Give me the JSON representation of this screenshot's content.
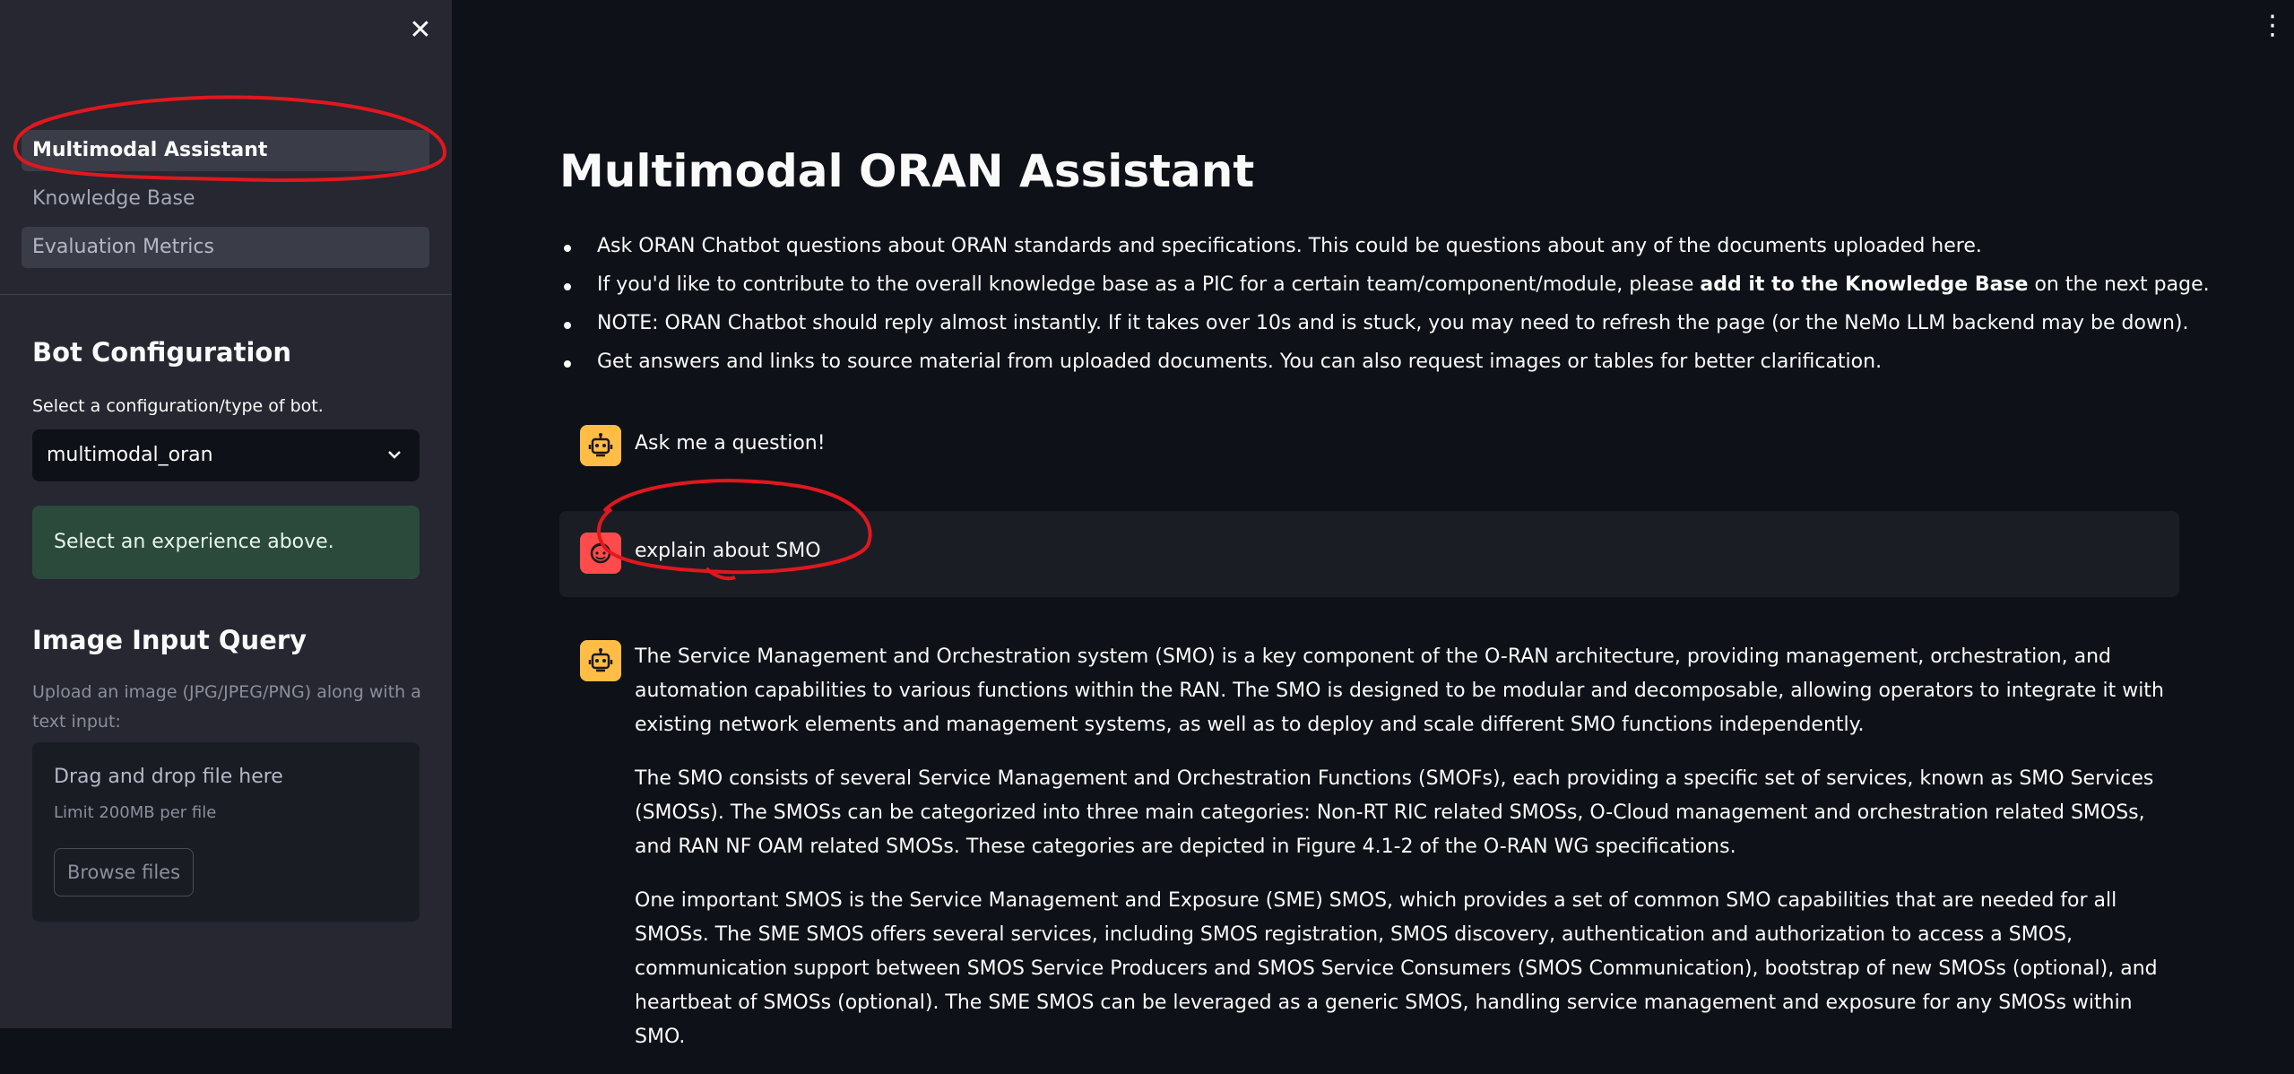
{
  "sidebar": {
    "nav": [
      "Multimodal Assistant",
      "Knowledge Base",
      "Evaluation Metrics"
    ],
    "bot_config": {
      "heading": "Bot Configuration",
      "label": "Select a configuration/type of bot.",
      "selected": "multimodal_oran",
      "info": "Select an experience above."
    },
    "image_query": {
      "heading": "Image Input Query",
      "help": "Upload an image (JPG/JPEG/PNG) along with a text input:",
      "drop_text": "Drag and drop file here",
      "limit": "Limit 200MB per file",
      "browse": "Browse files"
    }
  },
  "main": {
    "title": "Multimodal ORAN Assistant",
    "bullets": [
      "Ask ORAN Chatbot questions about ORAN standards and specifications. This could be questions about any of the documents uploaded here.",
      {
        "pre": "If you'd like to contribute to the overall knowledge base as a PIC for a certain team/component/module, please ",
        "bold": "add it to the Knowledge Base",
        "post": " on the next page."
      },
      "NOTE: ORAN Chatbot should reply almost instantly. If it takes over 10s and is stuck, you may need to refresh the page (or the NeMo LLM backend may be down).",
      "Get answers and links to source material from uploaded documents. You can also request images or tables for better clarification."
    ],
    "chat": {
      "greeting": "Ask me a question!",
      "user_question": "explain about SMO",
      "response": [
        "The Service Management and Orchestration system (SMO) is a key component of the O-RAN architecture, providing management, orchestration, and automation capabilities to various functions within the RAN. The SMO is designed to be modular and decomposable, allowing operators to integrate it with existing network elements and management systems, as well as to deploy and scale different SMO functions independently.",
        "The SMO consists of several Service Management and Orchestration Functions (SMOFs), each providing a specific set of services, known as SMO Services (SMOSs). The SMOSs can be categorized into three main categories: Non-RT RIC related SMOSs, O-Cloud management and orchestration related SMOSs, and RAN NF OAM related SMOSs. These categories are depicted in Figure 4.1-2 of the O-RAN WG specifications.",
        "One important SMOS is the Service Management and Exposure (SME) SMOS, which provides a set of common SMO capabilities that are needed for all SMOSs. The SME SMOS offers several services, including SMOS registration, SMOS discovery, authentication and authorization to access a SMOS, communication support between SMOS Service Producers and SMOS Service Consumers (SMOS Communication), bootstrap of new SMOSs (optional), and heartbeat of SMOSs (optional). The SME SMOS can be leveraged as a generic SMOS, handling service management and exposure for any SMOSs within SMO."
      ]
    }
  },
  "icons": {
    "close": "close-icon",
    "menu": "kebab-menu-icon",
    "bot": "robot-icon",
    "user": "user-face-icon",
    "chevron": "chevron-down-icon"
  },
  "colors": {
    "bg": "#0e1117",
    "sidebar": "#262730",
    "bot_avatar": "#ffbd45",
    "user_avatar": "#ff4b4b",
    "info_box": "#2b4a3b",
    "annotation": "#e0181e"
  }
}
